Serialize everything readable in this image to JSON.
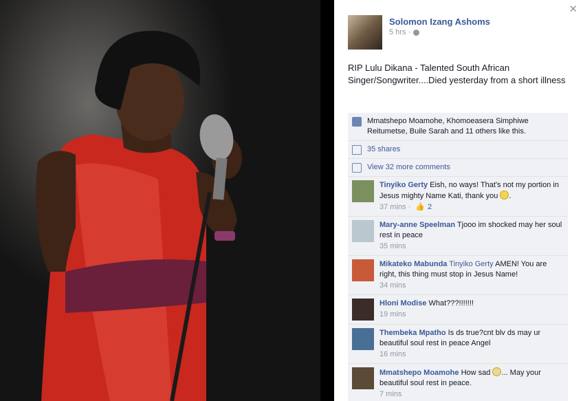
{
  "colors": {
    "brand": "#3b5998",
    "muted": "#9197a3",
    "ufi_bg": "#eff1f5"
  },
  "close_icon": "close-icon",
  "post": {
    "author": "Solomon Izang Ashoms",
    "time": "5 hrs ·",
    "text": "RIP Lulu Dikana - Talented South African Singer/Songwriter....Died yesterday from a short illness"
  },
  "ufi": {
    "likes_text": "Mmatshepo Moamohe, Khomoeasera Simphiwe Reitumetse, Buile Sarah and 11 others like this.",
    "shares": "35 shares",
    "view_more": "View 32 more comments"
  },
  "comments": [
    {
      "name": "Tinyiko Gerty",
      "text": "Eish, no ways! That's not my portion in Jesus mighty Name Kati, thank you",
      "time": "37 mins ·",
      "likes": "2",
      "avatar": "#7c8f5e"
    },
    {
      "name": "Mary-anne Speelman",
      "text": "Tjooo im shocked may her soul rest in peace",
      "time": "35 mins",
      "avatar": "#b9c7cf"
    },
    {
      "name": "Mikateko Mabunda",
      "mention": "Tinyiko Gerty",
      "text": "AMEN! You are right, this thing must stop in Jesus Name!",
      "time": "34 mins",
      "avatar": "#c85a3a"
    },
    {
      "name": "Hloni Modise",
      "text": "What???!!!!!!!",
      "time": "19 mins",
      "avatar": "#3a2c28"
    },
    {
      "name": "Thembeka Mpatho",
      "text": "Is ds true?cnt blv ds may ur beautiful soul rest in peace Angel",
      "time": "16 mins",
      "avatar": "#4a6f96"
    },
    {
      "name": "Mmatshepo Moamohe",
      "text": "How sad",
      "text2": "... May your beautiful soul rest in peace.",
      "time": "7 mins",
      "avatar": "#5a4a36"
    }
  ]
}
